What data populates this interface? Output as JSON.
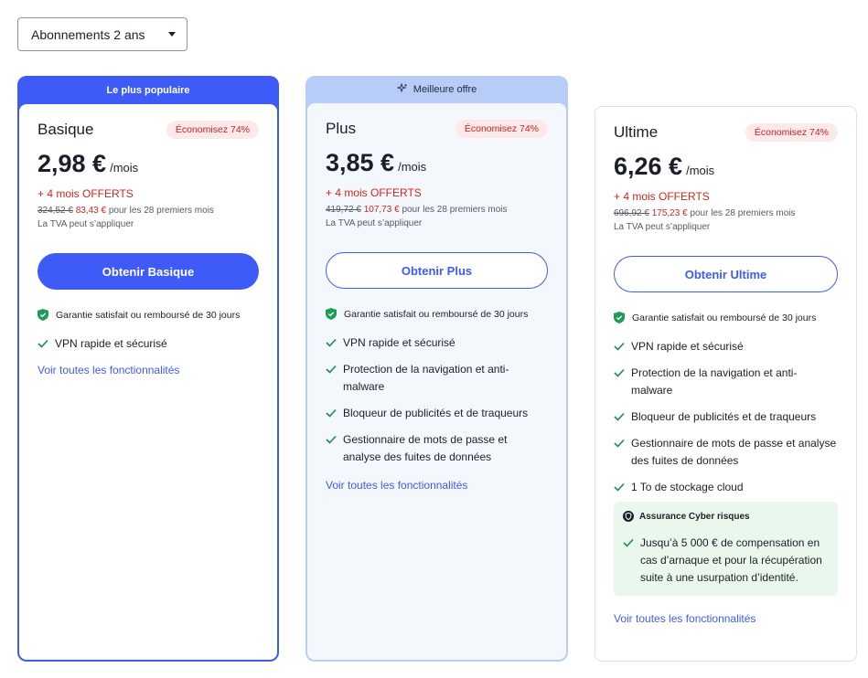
{
  "selector": {
    "value": "Abonnements 2 ans"
  },
  "plans": [
    {
      "banner": "Le plus populaire",
      "name": "Basique",
      "badge": "Économisez 74%",
      "price": "2,98 €",
      "per": "/mois",
      "offer": "+ 4 mois OFFERTS",
      "old_price": "324,52 €",
      "new_price": "83,43 €",
      "period": "pour les 28 premiers mois",
      "vat": "La TVA peut s’appliquer",
      "button": "Obtenir Basique",
      "guarantee": "Garantie satisfait ou remboursé de 30 jours",
      "features": [
        "VPN rapide et sécurisé"
      ],
      "see_all": "Voir toutes les fonctionnalités"
    },
    {
      "banner": "Meilleure offre",
      "name": "Plus",
      "badge": "Économisez 74%",
      "price": "3,85 €",
      "per": "/mois",
      "offer": "+ 4 mois OFFERTS",
      "old_price": "419,72 €",
      "new_price": "107,73 €",
      "period": "pour les 28 premiers mois",
      "vat": "La TVA peut s’appliquer",
      "button": "Obtenir Plus",
      "guarantee": "Garantie satisfait ou remboursé de 30 jours",
      "features": [
        "VPN rapide et sécurisé",
        "Protection de la navigation et anti-malware",
        "Bloqueur de publicités et de traqueurs",
        "Gestionnaire de mots de passe et analyse des fuites de données"
      ],
      "see_all": "Voir toutes les fonctionnalités"
    },
    {
      "name": "Ultime",
      "badge": "Économisez 74%",
      "price": "6,26 €",
      "per": "/mois",
      "offer": "+ 4 mois OFFERTS",
      "old_price": "696,92 €",
      "new_price": "175,23 €",
      "period": "pour les 28 premiers mois",
      "vat": "La TVA peut s’appliquer",
      "button": "Obtenir Ultime",
      "guarantee": "Garantie satisfait ou remboursé de 30 jours",
      "features": [
        "VPN rapide et sécurisé",
        "Protection de la navigation et anti-malware",
        "Bloqueur de publicités et de traqueurs",
        "Gestionnaire de mots de passe et analyse des fuites de données",
        "1 To de stockage cloud"
      ],
      "cyber": {
        "title": "Assurance Cyber risques",
        "item": "Jusqu’à 5 000 € de compensation en cas d’arnaque et pour la récupération suite à une usurpation d’identité."
      },
      "see_all": "Voir toutes les fonctionnalités"
    }
  ],
  "colors": {
    "accent": "#3e5bf7",
    "offer_red": "#d0261c",
    "check_green": "#1f8a4c"
  }
}
